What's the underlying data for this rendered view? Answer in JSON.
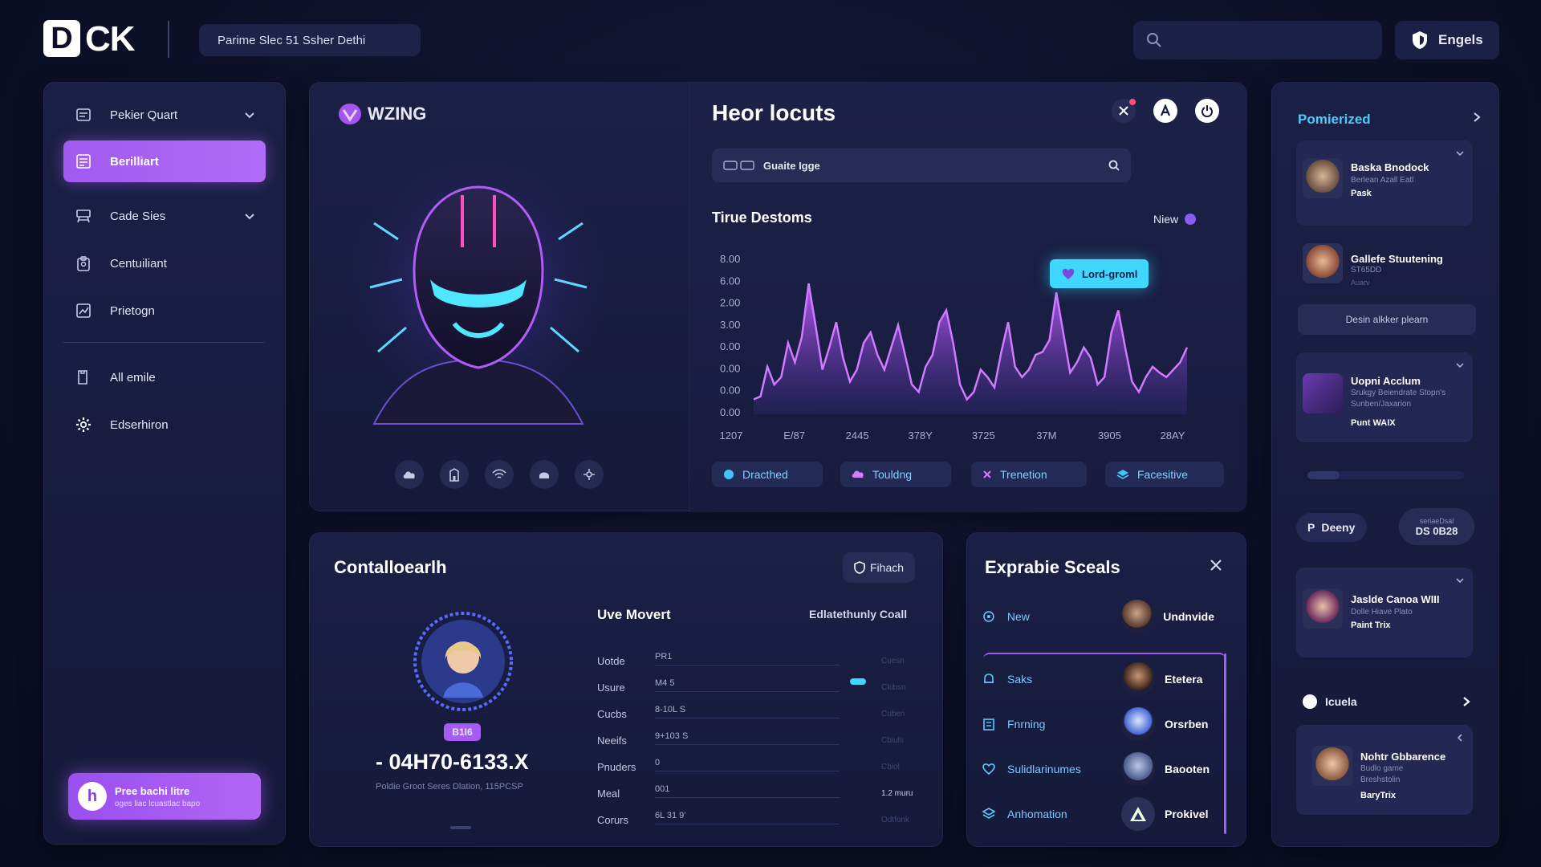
{
  "topbar": {
    "logo_letter": "D",
    "logo_text": "CK",
    "breadcrumb": "Parime Slec 51 Ssher Dethi",
    "lang_label": "Engels"
  },
  "sidebar": {
    "items": [
      {
        "label": "Pekier Quart",
        "icon": "document-icon"
      },
      {
        "label": "Berilliart",
        "icon": "list-icon"
      },
      {
        "label": "Cade Sies",
        "icon": "table-icon"
      },
      {
        "label": "Centuiliant",
        "icon": "clipboard-icon"
      },
      {
        "label": "Prietogn",
        "icon": "chart-icon"
      },
      {
        "label": "All emile",
        "icon": "folder-icon"
      },
      {
        "label": "Edserhiron",
        "icon": "gear-icon"
      }
    ],
    "promo": {
      "avatar": "h",
      "title": "Pree bachi litre",
      "subtitle": "oges liac lcuastlac bapo"
    }
  },
  "hero": {
    "brand": "WZING"
  },
  "chart_panel": {
    "title": "Heor locuts",
    "search_text": "Guaite Igge",
    "subtitle": "Tirue Destoms",
    "view_label": "Niew",
    "tooltip": "Lord-groml",
    "filters": [
      "Dracthed",
      "Touldng",
      "Trenetion",
      "Facesitive"
    ]
  },
  "chart_data": {
    "type": "area",
    "title": "Tirue Destoms",
    "y_tick_labels": [
      "8.00",
      "6.00",
      "2.00",
      "3.00",
      "0.00",
      "0.00",
      "0.00",
      "0.00"
    ],
    "x_tick_labels": [
      "1207",
      "E/87",
      "2445",
      "378Y",
      "3725",
      "37M",
      "3905",
      "28AY"
    ],
    "y": [
      0.1,
      0.12,
      0.32,
      0.2,
      0.25,
      0.48,
      0.35,
      0.52,
      0.88,
      0.6,
      0.3,
      0.45,
      0.62,
      0.38,
      0.22,
      0.3,
      0.48,
      0.55,
      0.4,
      0.3,
      0.45,
      0.6,
      0.4,
      0.2,
      0.15,
      0.32,
      0.4,
      0.62,
      0.7,
      0.48,
      0.2,
      0.1,
      0.15,
      0.3,
      0.25,
      0.18,
      0.42,
      0.62,
      0.32,
      0.25,
      0.3,
      0.4,
      0.42,
      0.5,
      0.82,
      0.55,
      0.28,
      0.35,
      0.45,
      0.38,
      0.2,
      0.25,
      0.55,
      0.7,
      0.45,
      0.22,
      0.15,
      0.25,
      0.32,
      0.28,
      0.25,
      0.3,
      0.35,
      0.45
    ],
    "ylim": [
      0,
      1
    ],
    "grid": false,
    "fill_color": "#a64cf0"
  },
  "contact": {
    "title": "Contalloearlh",
    "badge_btn": "Fihach",
    "level": "B1I6",
    "code": "- 04H70-6133.X",
    "caption": "Poldie Groot Seres Dlation, 115PCSP",
    "table_title": "Uve Movert",
    "table_right": "Edlatethunly Coall",
    "rows": [
      {
        "key": "Uotde",
        "val": "PR1",
        "side": "Cuesn"
      },
      {
        "key": "Usure",
        "val": "M4 5",
        "side": "Ckibsn"
      },
      {
        "key": "Cucbs",
        "val": "8-10L S",
        "side": "Cuben"
      },
      {
        "key": "Neeifs",
        "val": "9+103 S",
        "side": "Cbiuls"
      },
      {
        "key": "Pnuders",
        "val": "0",
        "side": "Cbiol"
      },
      {
        "key": "Meal",
        "val": "001",
        "side": "1.2 muru"
      },
      {
        "key": "Corurs",
        "val": "6L 31 9'",
        "side": "Odtfonk"
      }
    ]
  },
  "explore": {
    "title": "Exprabie Sceals",
    "rows": [
      {
        "label": "New",
        "name": "Undnvide",
        "icon": "badge-icon"
      },
      {
        "label": "Saks",
        "name": "Etetera",
        "icon": "bell-icon"
      },
      {
        "label": "Fnrning",
        "name": "Orsrben",
        "icon": "building-icon"
      },
      {
        "label": "Sulidlarinumes",
        "name": "Baooten",
        "icon": "heart-icon"
      },
      {
        "label": "Anhomation",
        "name": "Prokivel",
        "icon": "layers-icon"
      }
    ]
  },
  "right_panel": {
    "title": "Pomierized",
    "cards": [
      {
        "name": "Baska Bnodock",
        "sub": "Berlean Azall Eatl",
        "bold": "Pask"
      },
      {
        "name": "Gallefe Stuutening",
        "sub": "ST65DD",
        "bold": "Auarv"
      },
      {
        "name": "Uopni Acclum",
        "sub": "Srukgy Beiendrate Stopn's Sunben/Jaxarion",
        "bold": "Punt WAIX"
      },
      {
        "name": "Jaslde Canoa WIII",
        "sub": "Dolle Hiave Plato",
        "bold": "Paint Trix"
      },
      {
        "name": "Nohtr Gbbarence",
        "sub": "Budlo game Breshstolin",
        "bold": "BaryTrix"
      }
    ],
    "wide_btn": "Desin alkker plearn",
    "pill_left": "Deeny",
    "pill_right_top": "seriaeDsal",
    "pill_right": "DS 0B28",
    "section_label": "Icuela"
  },
  "colors": {
    "accent": "#a65cf2",
    "cyan": "#4fd9ff",
    "bg": "#0b1027"
  }
}
